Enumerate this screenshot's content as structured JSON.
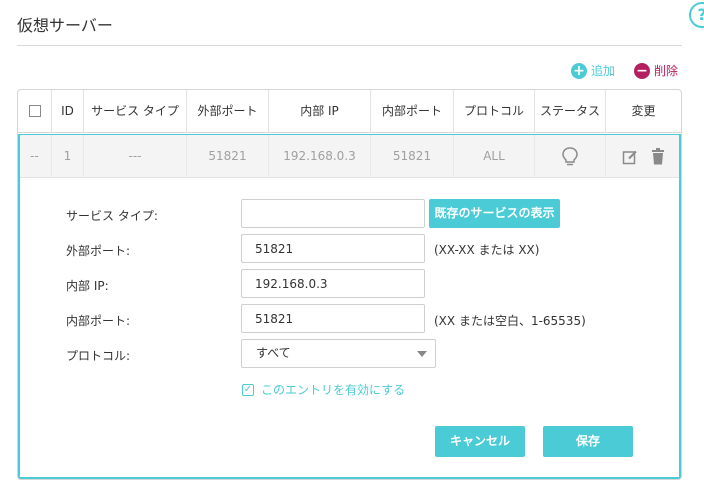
{
  "page": {
    "title": "仮想サーバー",
    "help_glyph": "?"
  },
  "toolbar": {
    "add_label": "追加",
    "delete_label": "削除",
    "add_icon": "plus-icon",
    "delete_icon": "minus-icon"
  },
  "table": {
    "columns": [
      "ID",
      "サービス タイプ",
      "外部ポート",
      "内部 IP",
      "内部ポート",
      "プロトコル",
      "ステータス",
      "変更"
    ],
    "row": {
      "select": "--",
      "id": "1",
      "service_type": "---",
      "external_port": "51821",
      "internal_ip": "192.168.0.3",
      "internal_port": "51821",
      "protocol": "ALL",
      "status_icon": "lightbulb-icon",
      "edit_icon": "edit-icon",
      "delete_icon": "trash-icon"
    }
  },
  "form": {
    "service_type_label": "サービス タイプ:",
    "service_type_value": "",
    "show_services_label": "既存のサービスの表示",
    "external_port_label": "外部ポート:",
    "external_port_value": "51821",
    "external_port_hint": "(XX-XX または XX)",
    "internal_ip_label": "内部 IP:",
    "internal_ip_value": "192.168.0.3",
    "internal_port_label": "内部ポート:",
    "internal_port_value": "51821",
    "internal_port_hint": "(XX または空白、1-65535)",
    "protocol_label": "プロトコル:",
    "protocol_value": "すべて",
    "enable_label": "このエントリを有効にする",
    "enable_checked": true,
    "cancel_label": "キャンセル",
    "save_label": "保存"
  },
  "colors": {
    "accent": "#4acbd6",
    "delete": "#b4205f"
  }
}
